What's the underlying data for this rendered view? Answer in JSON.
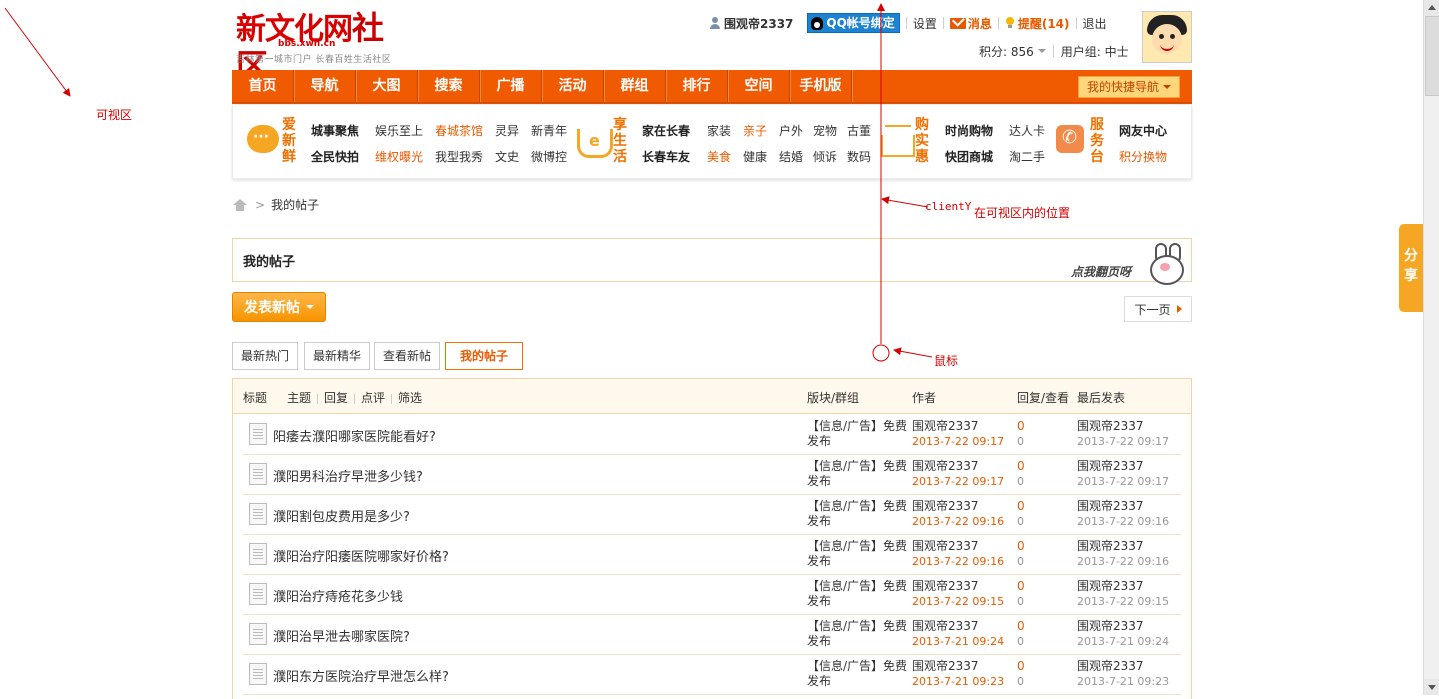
{
  "annotations": {
    "viewport_label": "可视区",
    "clienty_label": "clientY",
    "position_label": "在可视区内的位置",
    "mouse_label": "鼠标"
  },
  "header": {
    "logo_main": "新文化网",
    "logo_community": "社区",
    "logo_url": "bbs.xwh.cn",
    "logo_slogan": "吉林第一城市门户 长春百姓生活社区",
    "username": "围观帝2337",
    "qq_bind": "QQ帐号绑定",
    "settings": "设置",
    "messages": "消息",
    "reminders": "提醒(14)",
    "logout": "退出",
    "points": "积分: 856",
    "user_group": "用户组: 中士"
  },
  "main_nav": {
    "items": [
      "首页",
      "导航",
      "大图",
      "搜索",
      "广播",
      "活动",
      "群组",
      "排行",
      "空间",
      "手机版"
    ],
    "quick_nav": "我的快捷导航"
  },
  "categories": {
    "love_fresh": {
      "title": "爱新鲜",
      "row1": [
        "城事聚焦",
        "娱乐至上",
        "春城茶馆",
        "灵异",
        "新青年"
      ],
      "row2": [
        "全民快拍",
        "维权曝光",
        "我型我秀",
        "文史",
        "微博控"
      ]
    },
    "enjoy_life": {
      "title": "享生活",
      "row1": [
        "家在长春",
        "家装",
        "亲子",
        "户外",
        "宠物",
        "古董"
      ],
      "row2": [
        "长春车友",
        "美食",
        "健康",
        "结婚",
        "倾诉",
        "数码"
      ]
    },
    "shopping": {
      "title": "购实惠",
      "row1": [
        "时尚购物",
        "达人卡"
      ],
      "row2": [
        "快团商城",
        "淘二手"
      ]
    },
    "service": {
      "title": "服务台",
      "row1": [
        "网友中心"
      ],
      "row2": [
        "积分换物"
      ]
    }
  },
  "breadcrumb": {
    "sep": ">",
    "current": "我的帖子"
  },
  "page": {
    "title": "我的帖子",
    "flip_hint": "点我翻页呀",
    "next_page": "下一页",
    "new_post": "发表新帖"
  },
  "tabs": [
    "最新热门",
    "最新精华",
    "查看新帖",
    "我的帖子"
  ],
  "table": {
    "headers": {
      "label": "标题",
      "filter_topic": "主题",
      "filter_reply": "回复",
      "filter_review": "点评",
      "filter_select": "筛选",
      "forum": "版块/群组",
      "author": "作者",
      "reply_view": "回复/查看",
      "last_post": "最后发表"
    },
    "rows": [
      {
        "title": "阳痿去濮阳哪家医院能看好?",
        "forum": "【信息/广告】免费发布",
        "author": "围观帝2337",
        "date": "2013-7-22 09:17",
        "replies": "0",
        "views": "0",
        "last_author": "围观帝2337",
        "last_date": "2013-7-22 09:17"
      },
      {
        "title": "濮阳男科治疗早泄多少钱?",
        "forum": "【信息/广告】免费发布",
        "author": "围观帝2337",
        "date": "2013-7-22 09:17",
        "replies": "0",
        "views": "0",
        "last_author": "围观帝2337",
        "last_date": "2013-7-22 09:17"
      },
      {
        "title": "濮阳割包皮费用是多少?",
        "forum": "【信息/广告】免费发布",
        "author": "围观帝2337",
        "date": "2013-7-22 09:16",
        "replies": "0",
        "views": "0",
        "last_author": "围观帝2337",
        "last_date": "2013-7-22 09:16"
      },
      {
        "title": "濮阳治疗阳痿医院哪家好价格?",
        "forum": "【信息/广告】免费发布",
        "author": "围观帝2337",
        "date": "2013-7-22 09:16",
        "replies": "0",
        "views": "0",
        "last_author": "围观帝2337",
        "last_date": "2013-7-22 09:16"
      },
      {
        "title": "濮阳治疗痔疮花多少钱",
        "forum": "【信息/广告】免费发布",
        "author": "围观帝2337",
        "date": "2013-7-22 09:15",
        "replies": "0",
        "views": "0",
        "last_author": "围观帝2337",
        "last_date": "2013-7-22 09:15"
      },
      {
        "title": "濮阳治早泄去哪家医院?",
        "forum": "【信息/广告】免费发布",
        "author": "围观帝2337",
        "date": "2013-7-21 09:24",
        "replies": "0",
        "views": "0",
        "last_author": "围观帝2337",
        "last_date": "2013-7-21 09:24"
      },
      {
        "title": "濮阳东方医院治疗早泄怎么样?",
        "forum": "【信息/广告】免费发布",
        "author": "围观帝2337",
        "date": "2013-7-21 09:23",
        "replies": "0",
        "views": "0",
        "last_author": "围观帝2337",
        "last_date": "2013-7-21 09:23"
      }
    ]
  },
  "share": "分享",
  "colors": {
    "brand_orange": "#f05a00",
    "accent": "#e85a00",
    "annotation_red": "#d40000"
  }
}
